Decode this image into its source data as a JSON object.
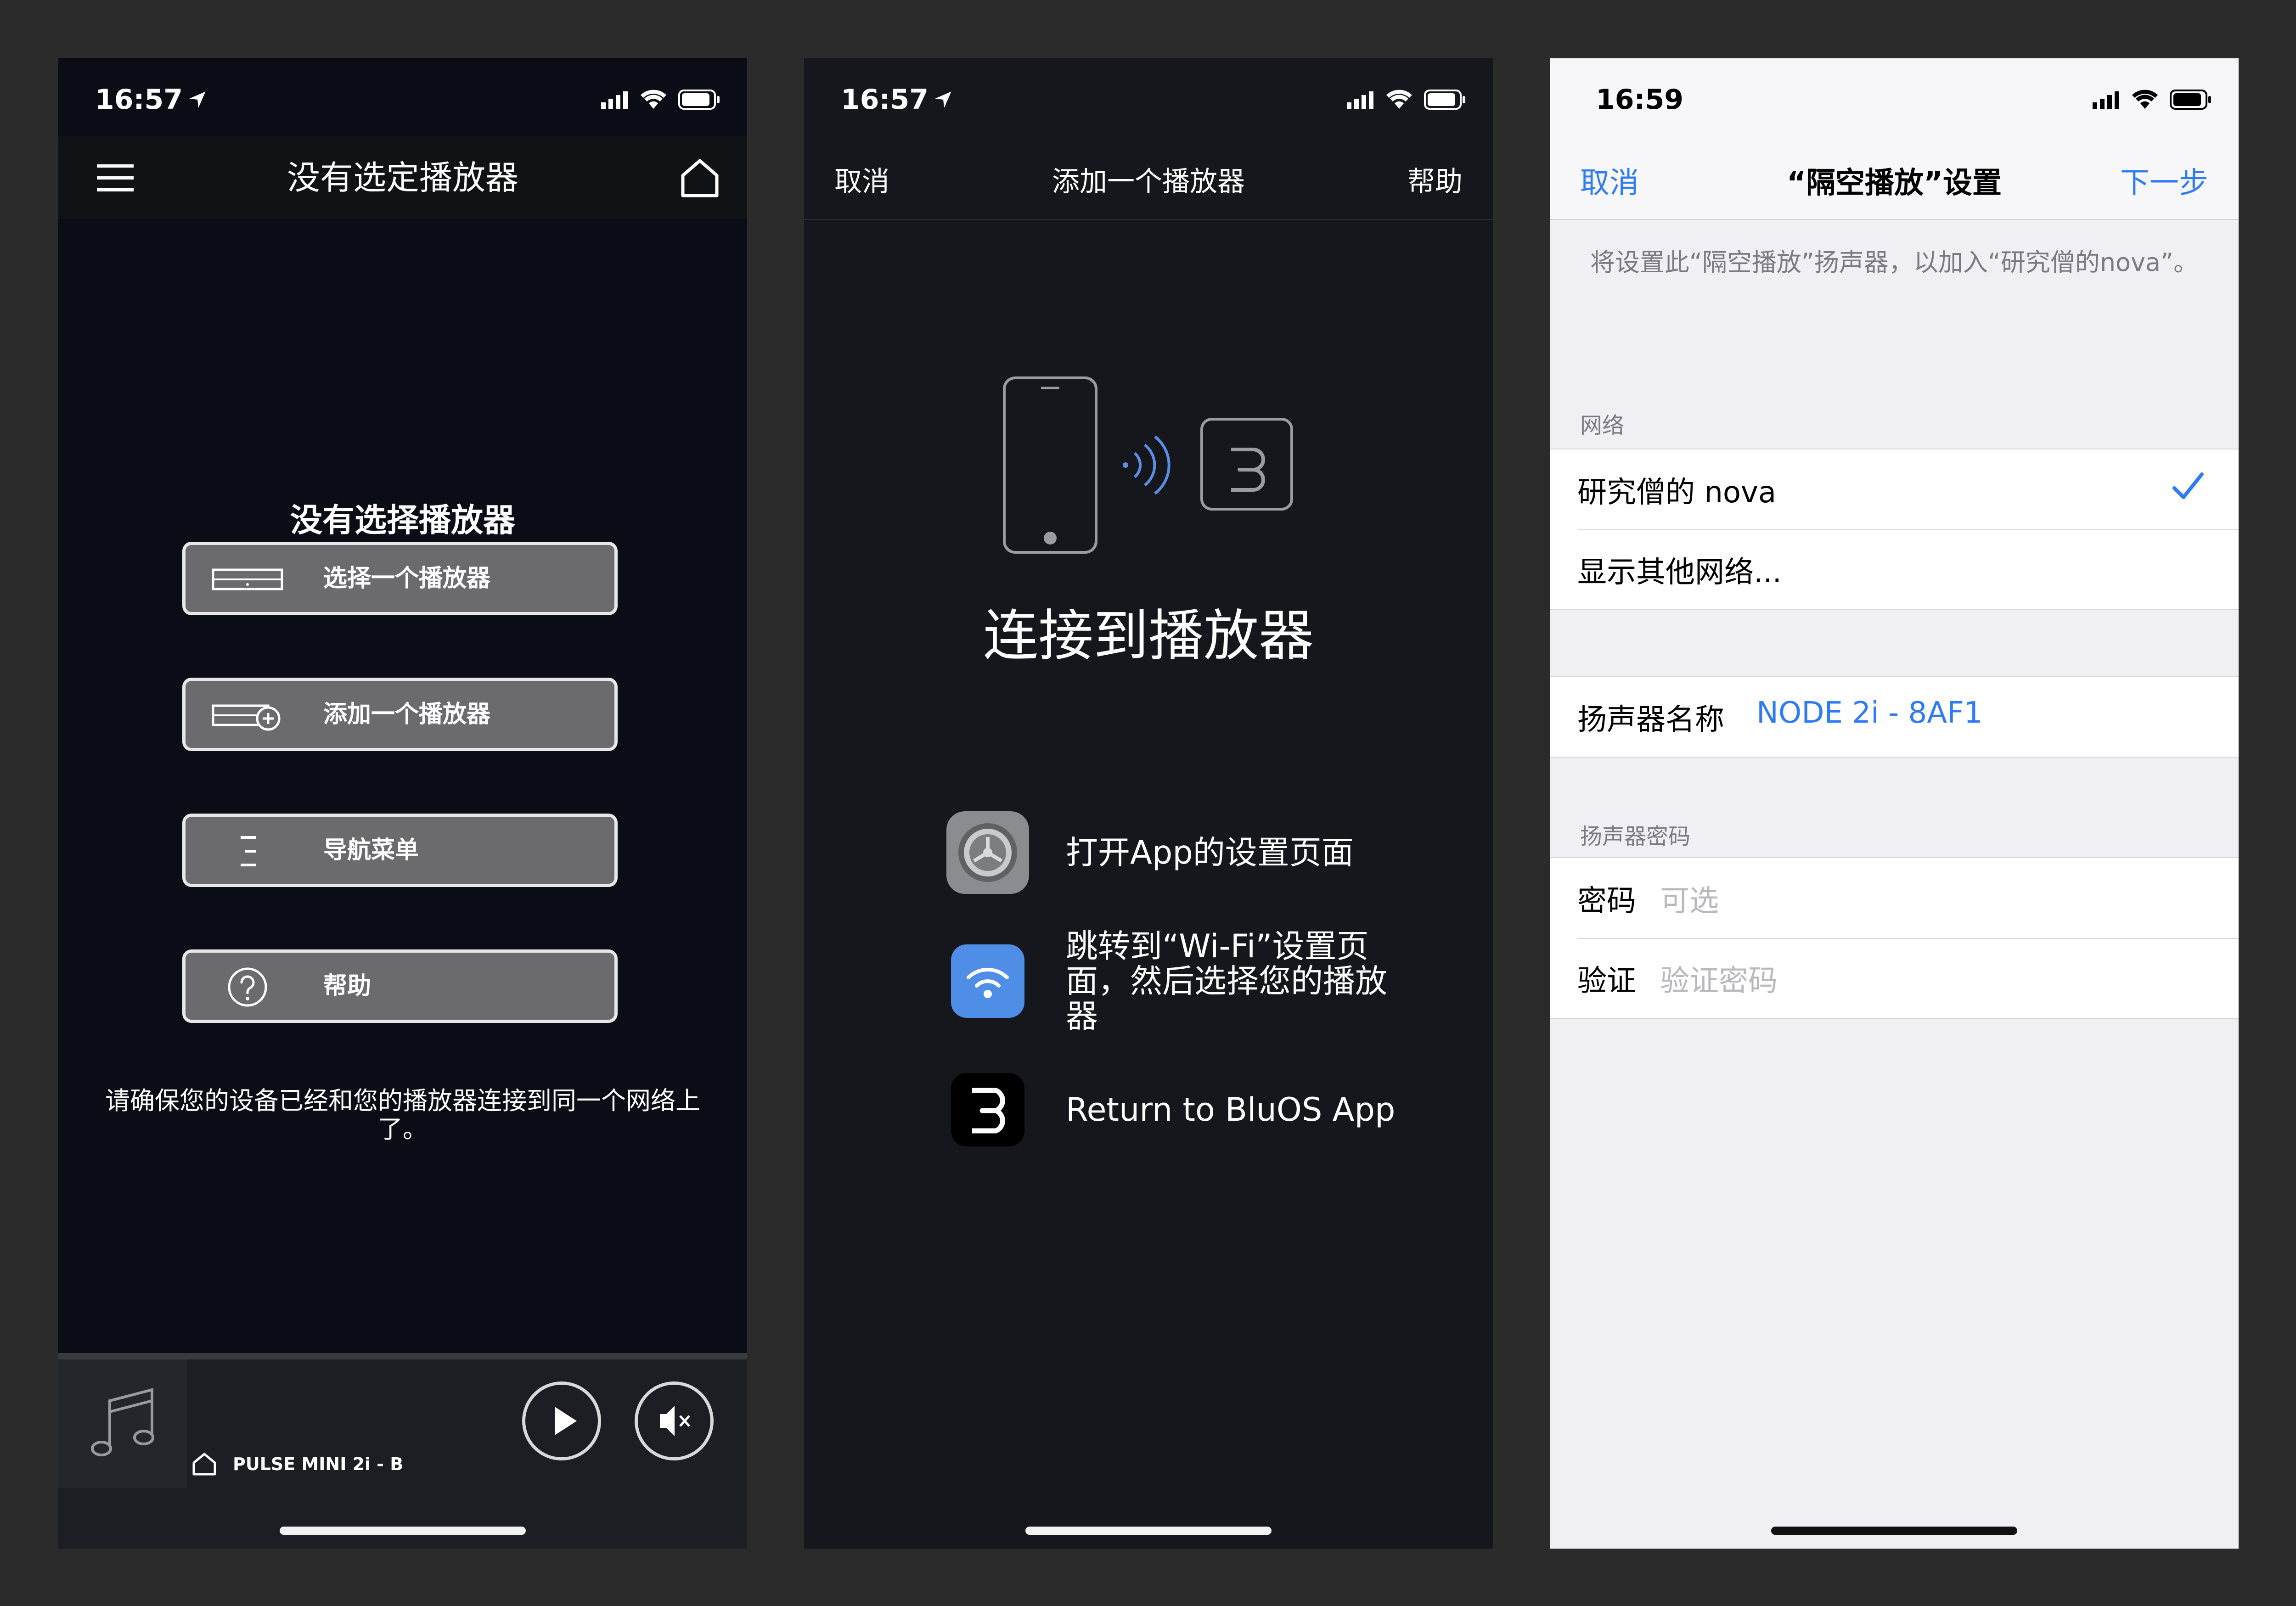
{
  "screens": [
    {
      "status": {
        "time": "16:57"
      },
      "nav": {
        "title": "没有选定播放器"
      },
      "heading": "没有选择播放器",
      "buttons": [
        {
          "label": "选择一个播放器",
          "icon": "player-device-icon"
        },
        {
          "label": "添加一个播放器",
          "icon": "add-player-icon"
        },
        {
          "label": "导航菜单",
          "icon": "navigation-list-icon"
        },
        {
          "label": "帮助",
          "icon": "help-circle-icon"
        }
      ],
      "note": "请确保您的设备已经和您的播放器连接到同一个网络上了。",
      "player": {
        "name": "PULSE MINI 2i - B"
      }
    },
    {
      "status": {
        "time": "16:57"
      },
      "nav": {
        "cancel": "取消",
        "title": "添加一个播放器",
        "help": "帮助"
      },
      "heading": "连接到播放器",
      "steps": [
        {
          "text": "打开App的设置页面",
          "icon": "settings-gear-icon"
        },
        {
          "text": "跳转到“Wi-Fi”设置页面，然后选择您的播放器",
          "icon": "wifi-icon"
        },
        {
          "text": "Return to BluOS App",
          "icon": "bluos-app-icon"
        }
      ]
    },
    {
      "status": {
        "time": "16:59"
      },
      "nav": {
        "cancel": "取消",
        "title": "“隔空播放”设置",
        "next": "下一步"
      },
      "description": "将设置此“隔空播放”扬声器，以加入“研究僧的nova”。",
      "network": {
        "header": "网络",
        "selected": "研究僧的 nova",
        "other": "显示其他网络..."
      },
      "speaker": {
        "label": "扬声器名称",
        "value": "NODE 2i - 8AF1"
      },
      "password": {
        "header": "扬声器密码",
        "password_label": "密码",
        "password_placeholder": "可选",
        "verify_label": "验证",
        "verify_placeholder": "验证密码"
      }
    }
  ],
  "colors": {
    "accent_blue": "#2f7bf5",
    "wifi_tile": "#4f8ee6"
  }
}
